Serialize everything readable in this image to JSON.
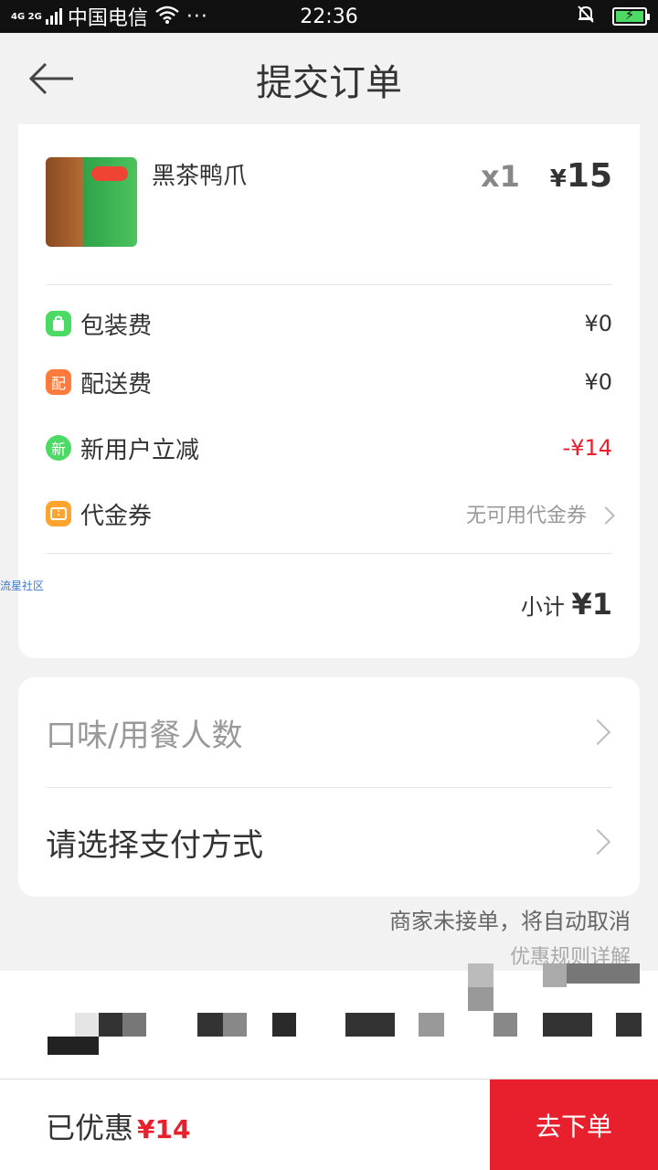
{
  "status_bar": {
    "signal_type": "4G 2G",
    "carrier": "中国电信",
    "more": "···",
    "time": "22:36"
  },
  "header": {
    "title": "提交订单",
    "back_icon": "arrow-left-icon"
  },
  "order": {
    "product": {
      "name": "黑茶鸭爪",
      "quantity": "x1",
      "currency": "¥",
      "price": "15"
    },
    "fees": [
      {
        "label": "包装费",
        "value": "¥0",
        "icon_text": "",
        "icon_color": "#4cd964"
      },
      {
        "label": "配送费",
        "value": "¥0",
        "icon_text": "配",
        "icon_color": "#ff7a3d"
      },
      {
        "label": "新用户立减",
        "value": "-¥14",
        "icon_text": "新",
        "icon_color": "#4cd964"
      },
      {
        "label": "代金券",
        "value": "无可用代金券",
        "icon_text": "",
        "icon_color": "#ffa42e"
      }
    ],
    "subtotal_label": "小计",
    "subtotal_amount": "¥1"
  },
  "watermark": "流星社区",
  "options": {
    "taste_label": "口味/用餐人数",
    "payment_label": "请选择支付方式"
  },
  "notice": {
    "line1": "商家未接单，将自动取消",
    "line2": "优惠规则详解"
  },
  "bottom_bar": {
    "discount_label": "已优惠",
    "discount_value": "¥14",
    "submit_label": "去下单"
  },
  "colors": {
    "accent_red": "#e8202e",
    "green": "#4cd964",
    "orange": "#ff7a3d"
  }
}
